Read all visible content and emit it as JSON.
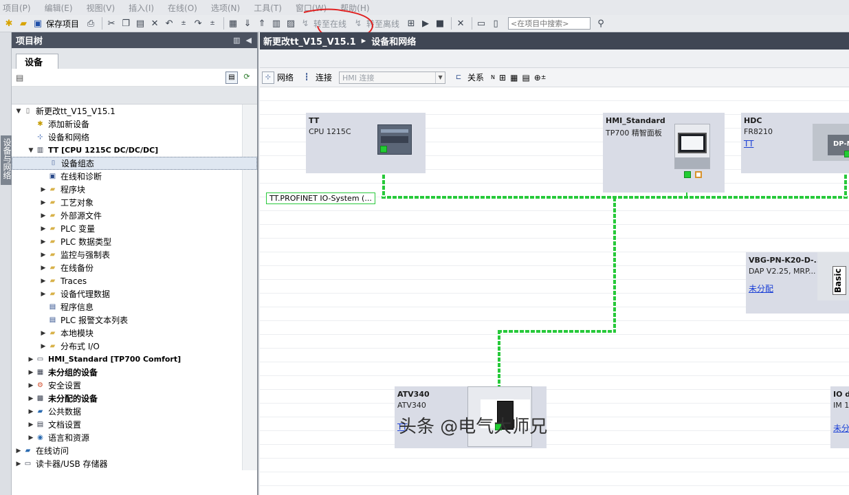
{
  "menu": {
    "items": [
      "项目(P)",
      "编辑(E)",
      "视图(V)",
      "插入(I)",
      "在线(O)",
      "选项(N)",
      "工具(T)",
      "窗口(W)",
      "帮助(H)"
    ]
  },
  "toolbar": {
    "save_label": "保存项目",
    "go_online_label": "转至在线",
    "go_offline_label": "转至离线",
    "search_placeholder": "<在项目中搜索>",
    "annotation_color": "#e02020"
  },
  "side_tab": {
    "label": "设备与网络"
  },
  "tree": {
    "header_title": "项目树",
    "tab_label": "设备",
    "items": [
      {
        "label": "新更改tt_V15_V15.1",
        "indent": 0,
        "arrow": "down",
        "icon": "project-icon",
        "bold": false
      },
      {
        "label": "添加新设备",
        "indent": 1,
        "arrow": "",
        "icon": "add-device-icon",
        "bold": false
      },
      {
        "label": "设备和网络",
        "indent": 1,
        "arrow": "",
        "icon": "network-icon",
        "bold": false
      },
      {
        "label": "TT [CPU 1215C DC/DC/DC]",
        "indent": 1,
        "arrow": "down",
        "icon": "plc-icon",
        "bold": false,
        "cpu": true
      },
      {
        "label": "设备组态",
        "indent": 2,
        "arrow": "",
        "icon": "device-config-icon",
        "bold": false,
        "selected": true
      },
      {
        "label": "在线和诊断",
        "indent": 2,
        "arrow": "",
        "icon": "diagnostics-icon",
        "bold": false
      },
      {
        "label": "程序块",
        "indent": 2,
        "arrow": "right",
        "icon": "folder-icon",
        "bold": false
      },
      {
        "label": "工艺对象",
        "indent": 2,
        "arrow": "right",
        "icon": "folder-icon",
        "bold": false
      },
      {
        "label": "外部源文件",
        "indent": 2,
        "arrow": "right",
        "icon": "folder-icon",
        "bold": false
      },
      {
        "label": "PLC 变量",
        "indent": 2,
        "arrow": "right",
        "icon": "folder-icon",
        "bold": false
      },
      {
        "label": "PLC 数据类型",
        "indent": 2,
        "arrow": "right",
        "icon": "folder-icon",
        "bold": false
      },
      {
        "label": "监控与强制表",
        "indent": 2,
        "arrow": "right",
        "icon": "folder-icon",
        "bold": false
      },
      {
        "label": "在线备份",
        "indent": 2,
        "arrow": "right",
        "icon": "folder-icon",
        "bold": false
      },
      {
        "label": "Traces",
        "indent": 2,
        "arrow": "right",
        "icon": "folder-icon",
        "bold": false
      },
      {
        "label": "设备代理数据",
        "indent": 2,
        "arrow": "right",
        "icon": "folder-icon",
        "bold": false
      },
      {
        "label": "程序信息",
        "indent": 2,
        "arrow": "",
        "icon": "program-info-icon",
        "bold": false
      },
      {
        "label": "PLC 报警文本列表",
        "indent": 2,
        "arrow": "",
        "icon": "alarm-text-icon",
        "bold": false
      },
      {
        "label": "本地模块",
        "indent": 2,
        "arrow": "right",
        "icon": "folder-icon",
        "bold": false
      },
      {
        "label": "分布式 I/O",
        "indent": 2,
        "arrow": "right",
        "icon": "folder-icon",
        "bold": false
      },
      {
        "label": "HMI_Standard [TP700 Comfort]",
        "indent": 1,
        "arrow": "right",
        "icon": "hmi-icon",
        "bold": false,
        "cpu": true
      },
      {
        "label": "未分组的设备",
        "indent": 1,
        "arrow": "right",
        "icon": "ungrouped-icon",
        "bold": true
      },
      {
        "label": "安全设置",
        "indent": 1,
        "arrow": "right",
        "icon": "security-icon",
        "bold": false
      },
      {
        "label": "未分配的设备",
        "indent": 1,
        "arrow": "right",
        "icon": "unassigned-icon",
        "bold": true
      },
      {
        "label": "公共数据",
        "indent": 1,
        "arrow": "right",
        "icon": "common-data-icon",
        "bold": false
      },
      {
        "label": "文档设置",
        "indent": 1,
        "arrow": "right",
        "icon": "document-icon",
        "bold": false
      },
      {
        "label": "语言和资源",
        "indent": 1,
        "arrow": "right",
        "icon": "language-icon",
        "bold": false
      },
      {
        "label": "在线访问",
        "indent": 0,
        "arrow": "right",
        "icon": "online-access-icon",
        "bold": false
      },
      {
        "label": "读卡器/USB 存储器",
        "indent": 0,
        "arrow": "right",
        "icon": "card-reader-icon",
        "bold": false
      }
    ]
  },
  "editor": {
    "breadcrumb_project": "新更改tt_V15_V15.1",
    "breadcrumb_sep": "▸",
    "breadcrumb_page": "设备和网络",
    "toolbar": {
      "network_label": "网络",
      "connections_label": "连接",
      "connection_type": "HMI 连接",
      "relations_label": "关系"
    }
  },
  "canvas": {
    "network_label": "TT.PROFINET IO-System (...",
    "devices": {
      "tt": {
        "name": "TT",
        "type": "CPU 1215C"
      },
      "hmi": {
        "name": "HMI_Standard",
        "type": "TP700 精智面板"
      },
      "hdc": {
        "name": "HDC",
        "type": "FR8210",
        "link": "TT",
        "tag": "DP-N"
      },
      "vbg": {
        "name": "VBG-PN-K20-D-...",
        "type": "DAP V2.25, MRP...",
        "link": "未分配",
        "tag": "Basic"
      },
      "atv": {
        "name": "ATV340",
        "type": "ATV340",
        "link": "TT"
      },
      "io": {
        "name": "IO d",
        "type": "IM 1",
        "link": "未分"
      }
    },
    "network_color": "#27c93a"
  },
  "watermark": "头条 @电气大师兄"
}
